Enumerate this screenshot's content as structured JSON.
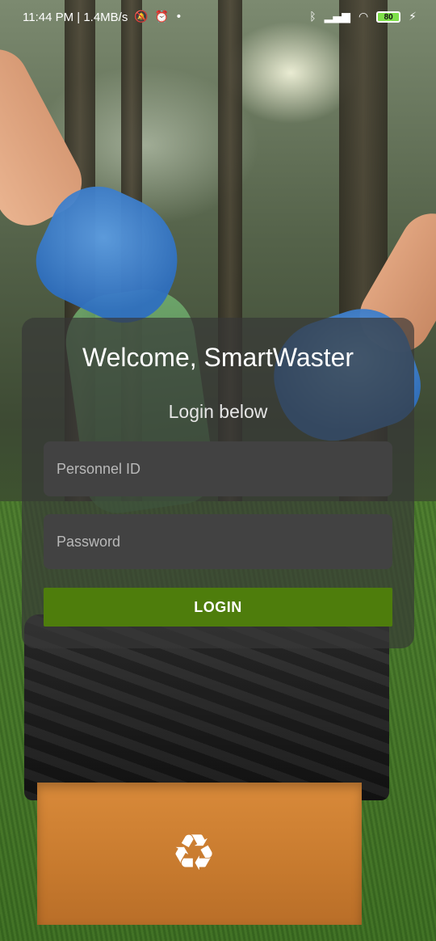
{
  "status_bar": {
    "time_speed": "11:44 PM | 1.4MB/s",
    "battery": "80",
    "icons": [
      "mute-icon",
      "alarm-icon",
      "dot-icon",
      "bluetooth-icon",
      "signal-icon",
      "wifi-icon",
      "battery-icon",
      "charging-icon"
    ]
  },
  "login": {
    "title": "Welcome, SmartWaster",
    "subtitle": "Login below",
    "personnel_placeholder": "Personnel ID",
    "password_placeholder": "Password",
    "button_label": "LOGIN"
  },
  "colors": {
    "button": "#4e7d0c",
    "card": "#373737",
    "field": "#424242"
  },
  "background": {
    "icon": "recycle-icon"
  }
}
